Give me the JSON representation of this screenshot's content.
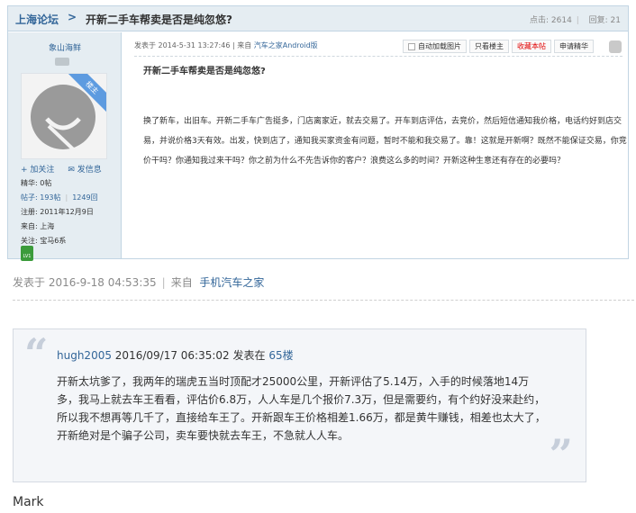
{
  "thread": {
    "forum": "上海论坛",
    "separator": ">",
    "title": "开新二手车帮卖是否是纯忽悠?",
    "views_label": "点击: 2614",
    "replies_label": "回复: 21"
  },
  "author": {
    "name": "象山海鲜",
    "owner_badge": "楼主",
    "follow": "加关注",
    "message": "发信息",
    "essence": "精华: 0帖",
    "posts": "帖子: 193帖",
    "replies": "1249回",
    "registered": "注册: 2011年12月9日",
    "from": "来自: 上海",
    "follows": "关注: 宝马6系",
    "level": "LV1"
  },
  "post": {
    "meta": "发表于 2014-5-31 13:27:46 | 来自 ",
    "meta_source": "汽车之家Android版",
    "tools": {
      "auto_load": "自动加载图片",
      "only_owner": "只看楼主",
      "favorite": "收藏本帖",
      "apply_essence": "申请精华"
    },
    "title": "开新二手车帮卖是否是纯忽悠?",
    "body": "换了新车，出旧车。开新二手车广告挺多，门店离家近，就去交易了。开车到店评估，去竞价，然后短信通知我价格，电话约好到店交易，并说价格3天有效。出发，快到店了，通知我买家资金有问题，暂时不能和我交易了。靠！这就是开新啊？既然不能保证交易，你竞价干吗？你通知我过来干吗？你之前为什么不先告诉你的客户？浪费这么多的时间？开新这种生意还有存在的必要吗？"
  },
  "reply_meta": {
    "posted": "发表于 2016-9-18 04:53:35",
    "separator": "|",
    "from": "来自",
    "source": "手机汽车之家"
  },
  "quote": {
    "author": "hugh2005",
    "time": " 2016/09/17 06:35:02 发表在 ",
    "floor": "65楼",
    "body": "开新太坑爹了，我两年的瑞虎五当时顶配才25000公里，开新评估了5.14万，入手的时候落地14万多，我马上就去车王看看，评估价6.8万，人人车是几个报价7.3万，但是需要约，有个约好没来赴约，所以我不想再等几千了，直接给车王了。开新跟车王价格相差1.66万，都是黄牛赚钱，相差也太大了，开新绝对是个骗子公司，卖车要快就去车王，不急就人人车。"
  },
  "reply_text": "Mark",
  "colors": {
    "link": "#336699",
    "header_bg": "#e5edf2",
    "favorite_red": "#e00000",
    "quote_bg": "#f4f6f9"
  },
  "icons": [
    "avatar-placeholder-icon",
    "add-follow-icon",
    "message-icon",
    "level-badge-icon",
    "puzzle-icon",
    "quote-open-icon",
    "quote-close-icon"
  ]
}
